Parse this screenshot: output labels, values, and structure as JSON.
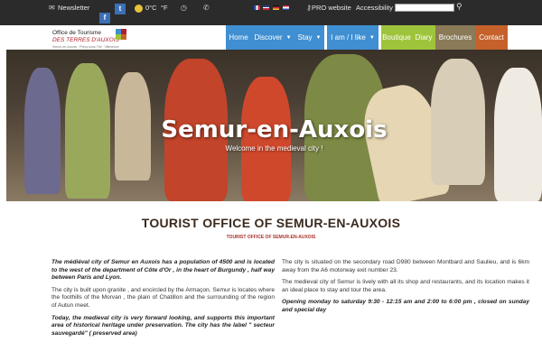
{
  "topbar": {
    "newsletter_label": "Newsletter",
    "temperature": "0°C",
    "unit_f": "°F",
    "pro_label": "PRO website",
    "accessibility_label": "Accessibility",
    "search_placeholder": "",
    "social": [
      {
        "icon": "twitter-icon",
        "glyph": "t"
      },
      {
        "icon": "facebook-icon",
        "glyph": "f"
      }
    ],
    "flags": [
      {
        "name": "flag-french",
        "colors": [
          "#2b4ba8",
          "#ffffff",
          "#d22b2b"
        ]
      },
      {
        "name": "flag-english",
        "colors": [
          "#2b3f8c",
          "#ffffff",
          "#c8263a"
        ]
      },
      {
        "name": "flag-german",
        "colors": [
          "#111111",
          "#d22b2b",
          "#e9c12e"
        ]
      },
      {
        "name": "flag-dutch",
        "colors": [
          "#c8263a",
          "#ffffff",
          "#2b4ba8"
        ]
      }
    ]
  },
  "logo": {
    "line1": "Office de Tourisme",
    "line2": "DES TERRES D'AUXOIS",
    "line3": "Semur-en-Auxois · Précy-sous-Thil · Villeneuve"
  },
  "nav": {
    "items": [
      {
        "label": "Home",
        "color": "#3f8fd2",
        "caret": false
      },
      {
        "label": "Discover",
        "color": "#3f8fd2",
        "caret": true
      },
      {
        "label": "Stay",
        "color": "#3f8fd2",
        "caret": true
      },
      {
        "label": "I am / I like",
        "color": "#3f8fd2",
        "caret": true
      },
      {
        "label": "Boutique",
        "color": "#9ec43b",
        "caret": false
      },
      {
        "label": "Diary",
        "color": "#9ec43b",
        "caret": false
      },
      {
        "label": "Brochures",
        "color": "#8a7a57",
        "caret": false
      },
      {
        "label": "Contact",
        "color": "#c6612b",
        "caret": false
      }
    ]
  },
  "hero": {
    "title": "Semur-en-Auxois",
    "subtitle": "Welcome in the medieval city !"
  },
  "content": {
    "title": "TOURIST OFFICE OF SEMUR-EN-AUXOIS",
    "subtitle": "TOURIST OFFICE OF SEMUR-EN-AUXOIS",
    "left": {
      "p1": "The médiéval city of Semur en Auxois has a population of 4500 and is located to the west of the department of Côte d'Or , in the heart of Burgundy , half way between Paris and Lyon.",
      "p2": "The city is built upon granite , and encircled by the Armaçon. Semur is locates where the foothills of the Morvan , the plain of Chatillon and the surrounding of the region of Autun meet.",
      "p3": "Today, the medieval city is very forward looking, and supports this important area of historical heritage under preservation. The city has the label \" secteur sauvegardé\" ( preserved area)"
    },
    "right": {
      "p1": "The city is situated on the secondary road D980 between Montbard and Saulieu, and is 6km away from the A6 motorway exit number 23.",
      "p2": "The medieval city of Semur is lively with all its shop and restaurants, and its location makes it an ideal place to stay and tour the area.",
      "p3": "Opening monday to saturday 9:30 - 12:15 am and 2:00 to 6:00 pm , closed on sunday and special day"
    }
  }
}
